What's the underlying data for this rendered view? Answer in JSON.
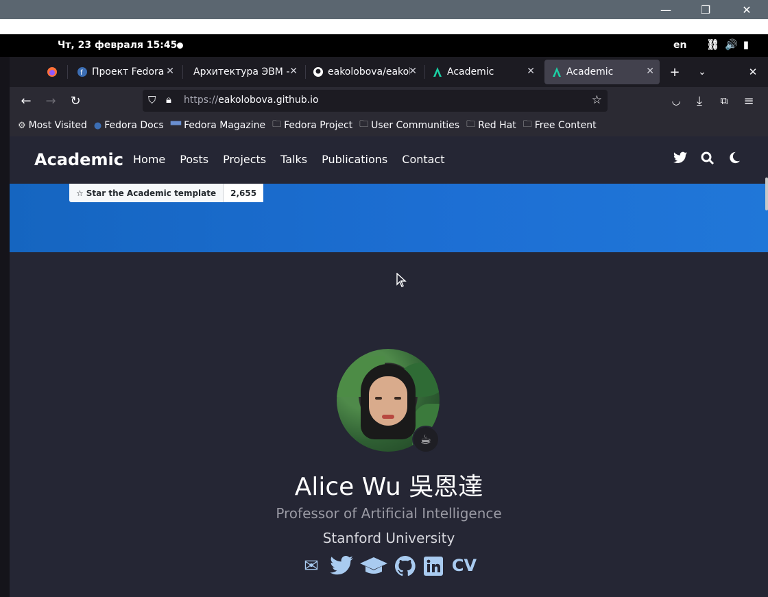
{
  "host": {
    "minimize": "—",
    "restore": "❐",
    "close": "✕"
  },
  "gnome": {
    "clock": "Чт, 23 февраля  15:45",
    "lang": "en"
  },
  "tabs": [
    {
      "label": "Проект Fedora —",
      "active": false
    },
    {
      "label": "Архитектура ЭВМ - Ј",
      "active": false
    },
    {
      "label": "eakolobova/eakol",
      "active": false
    },
    {
      "label": "Academic",
      "active": false
    },
    {
      "label": "Academic",
      "active": true
    }
  ],
  "url": {
    "proto": "https://",
    "host": "eakolobova.github.io"
  },
  "bookmarks": [
    {
      "icon": "gear-icon",
      "label": "Most Visited"
    },
    {
      "icon": "fedora-icon",
      "label": "Fedora Docs"
    },
    {
      "icon": "fm-icon",
      "label": "Fedora Magazine"
    },
    {
      "icon": "folder-icon",
      "label": "Fedora Project"
    },
    {
      "icon": "folder-icon",
      "label": "User Communities"
    },
    {
      "icon": "folder-icon",
      "label": "Red Hat"
    },
    {
      "icon": "folder-icon",
      "label": "Free Content"
    }
  ],
  "site": {
    "brand": "Academic",
    "menu": [
      "Home",
      "Posts",
      "Projects",
      "Talks",
      "Publications",
      "Contact"
    ],
    "star_label": "Star the Academic template",
    "star_count": "2,655"
  },
  "profile": {
    "name": "Alice Wu 吳恩達",
    "role": "Professor of Artificial Intelligence",
    "org": "Stanford University",
    "cv": "CV"
  },
  "colors": {
    "hero": "#1565c0",
    "page_bg": "#252634",
    "social": "#a9cbf0"
  }
}
